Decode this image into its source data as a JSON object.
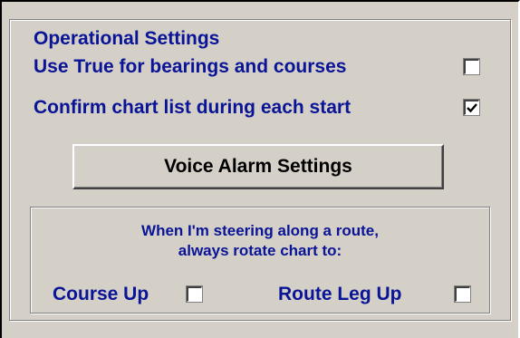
{
  "group": {
    "title": "Operational Settings"
  },
  "options": {
    "use_true_label": "Use True for bearings and courses",
    "use_true_checked": false,
    "confirm_chart_label": "Confirm chart list during each start",
    "confirm_chart_checked": true
  },
  "voice_alarm_button": "Voice Alarm Settings",
  "rotation": {
    "line1": "When I'm steering along a route,",
    "line2": "always rotate chart to:",
    "course_up_label": "Course Up",
    "course_up_checked": false,
    "route_leg_up_label": "Route Leg Up",
    "route_leg_up_checked": false
  },
  "colors": {
    "label_text": "#0a1496",
    "background": "#d4d0c8"
  }
}
